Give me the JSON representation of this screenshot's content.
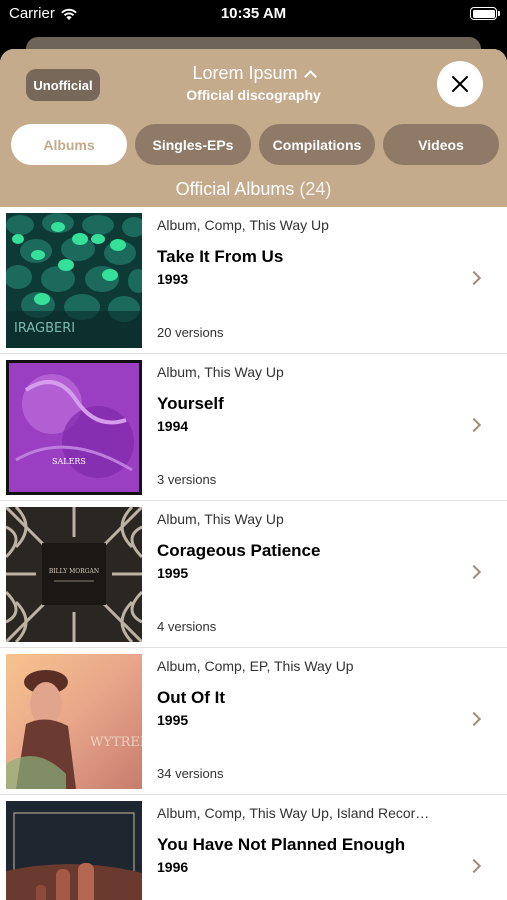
{
  "status_bar": {
    "carrier": "Carrier",
    "time": "10:35 AM"
  },
  "header": {
    "unofficial_label": "Unofficial",
    "title": "Lorem Ipsum",
    "subtitle": "Official discography"
  },
  "tabs": [
    {
      "label": "Albums",
      "active": true
    },
    {
      "label": "Singles-EPs",
      "active": false
    },
    {
      "label": "Compilations",
      "active": false
    },
    {
      "label": "Videos",
      "active": false
    }
  ],
  "section": {
    "title": "Official Albums",
    "count": "(24)"
  },
  "albums": [
    {
      "meta": "Album, Comp, This Way Up",
      "title": "Take It From Us",
      "year": "1993",
      "versions": "20 versions",
      "cover_text": "IRAGBERI"
    },
    {
      "meta": "Album, This Way Up",
      "title": "Yourself",
      "year": "1994",
      "versions": "3 versions",
      "cover_text": "SALERS"
    },
    {
      "meta": "Album, This Way Up",
      "title": "Corageous Patience",
      "year": "1995",
      "versions": "4 versions",
      "cover_text": "BILLY MORGAN"
    },
    {
      "meta": "Album, Comp, EP, This Way Up",
      "title": "Out Of It",
      "year": "1995",
      "versions": "34 versions",
      "cover_text": "WYTREN LEON"
    },
    {
      "meta": "Album, Comp, This Way Up, Island Recor…",
      "title": "You Have Not Planned Enough",
      "year": "1996",
      "versions": "",
      "cover_text": ""
    }
  ],
  "colors": {
    "header_bg": "#c4ab8c",
    "tab_bg": "#8f7a67",
    "unofficial_bg": "#78685a",
    "chevron": "#a08c78"
  }
}
